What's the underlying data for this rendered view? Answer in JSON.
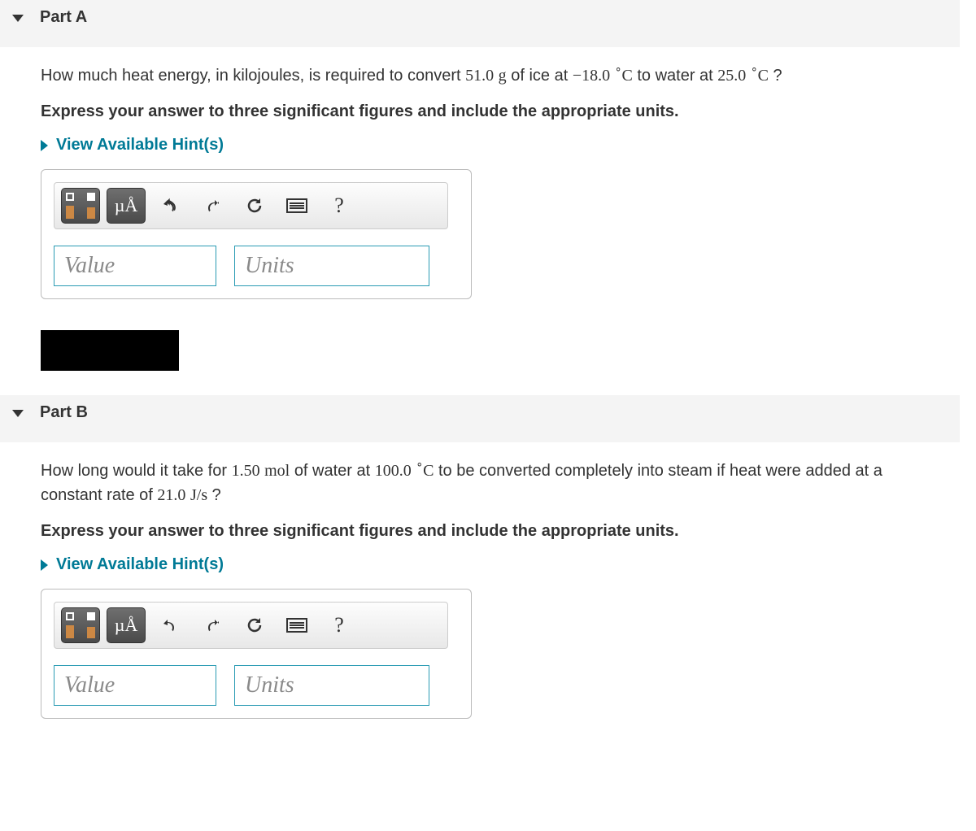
{
  "partA": {
    "title": "Part A",
    "question_prefix": "How much heat energy, in kilojoules, is required to convert ",
    "mass": "51.0",
    "mass_unit": "g",
    "mid1": " of ice at ",
    "t1_sign": "−",
    "t1_val": "18.0",
    "deg": "∘",
    "c": "C",
    "mid2": " to water at ",
    "t2_val": " 25.0",
    "qmark": " ?",
    "instruction": "Express your answer to three significant figures and include the appropriate units.",
    "hints": "View Available Hint(s)",
    "special": "µÅ",
    "help": "?",
    "value_ph": "Value",
    "units_ph": "Units"
  },
  "partB": {
    "title": "Part B",
    "q_prefix": "How long would it take for ",
    "mol_val": "1.50",
    "mol_unit": "mol",
    "mid1": " of water at ",
    "t_val": "100.0",
    "deg": "∘",
    "c": "C",
    "mid2": " to be converted completely into steam if heat were added at a constant rate of ",
    "rate_val": "21.0",
    "rate_unit": "J/s",
    "qmark": " ?",
    "instruction": "Express your answer to three significant figures and include the appropriate units.",
    "hints": "View Available Hint(s)",
    "special": "µÅ",
    "help": "?",
    "value_ph": "Value",
    "units_ph": "Units"
  }
}
